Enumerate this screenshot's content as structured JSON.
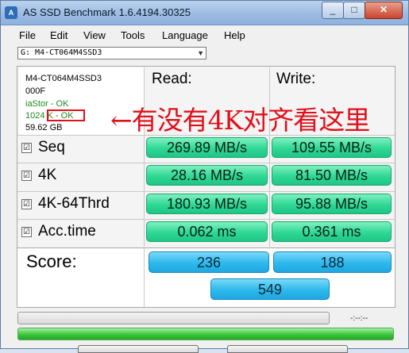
{
  "window": {
    "title": "AS SSD Benchmark 1.6.4194.30325",
    "min": "_",
    "max": "□",
    "close": "✕"
  },
  "menu": [
    "File",
    "Edit",
    "View",
    "Tools",
    "Language",
    "Help"
  ],
  "drive_select": {
    "value": "G: M4-CT064M4SSD3"
  },
  "info": {
    "model": "M4-CT064M4SSD3",
    "firmware": "000F",
    "driver": "iaStor - OK",
    "alignment": "1024 K - OK",
    "size": "59.62 GB"
  },
  "headers": {
    "read": "Read:",
    "write": "Write:"
  },
  "rows": [
    {
      "label": "Seq",
      "read": "269.89 MB/s",
      "write": "109.55 MB/s",
      "checked": "☑"
    },
    {
      "label": "4K",
      "read": "28.16 MB/s",
      "write": "81.50 MB/s",
      "checked": "☑"
    },
    {
      "label": "4K-64Thrd",
      "read": "180.93 MB/s",
      "write": "95.88 MB/s",
      "checked": "☑"
    },
    {
      "label": "Acc.time",
      "read": "0.062 ms",
      "write": "0.361 ms",
      "checked": "☑"
    }
  ],
  "score": {
    "label": "Score:",
    "read": "236",
    "write": "188",
    "total": "549"
  },
  "annotation": "←有没有4K对齐看这里",
  "status": {
    "timer": "-:--:--",
    "progress_fraction": 0,
    "progress2_fraction": 1
  },
  "colors": {
    "result_green": "#2fd895",
    "score_blue": "#2eb8ec",
    "annotation_red": "#e0101a"
  }
}
